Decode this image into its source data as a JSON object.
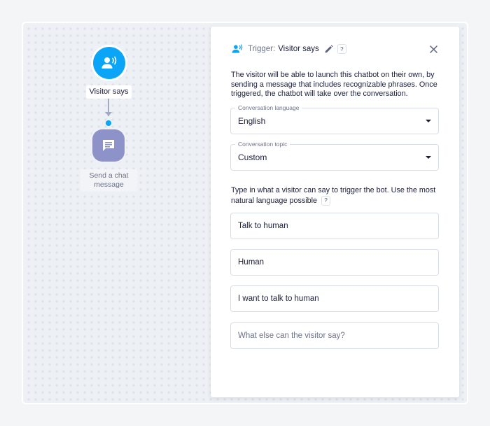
{
  "canvas": {
    "nodes": [
      {
        "type": "trigger",
        "label": "Visitor says",
        "icon": "visitor-speaking-icon",
        "color": "#0ba5f7"
      },
      {
        "type": "action",
        "label": "Send a chat message",
        "icon": "chat-message-icon",
        "color": "#8d92c9"
      }
    ]
  },
  "panel": {
    "header": {
      "icon": "visitor-speaking-icon",
      "prefix": "Trigger:",
      "title": "Visitor says",
      "edit_icon": "pencil-icon",
      "help": "?",
      "close_icon": "close-icon"
    },
    "description": "The visitor will be able to launch this chatbot on their own, by sending a message that includes recognizable phrases. Once triggered, the chatbot will take over the conversation.",
    "language": {
      "label": "Conversation language",
      "value": "English"
    },
    "topic": {
      "label": "Conversation topic",
      "value": "Custom"
    },
    "phrases_label": "Type in what a visitor can say to trigger the bot. Use the most natural language possible",
    "phrases_help": "?",
    "phrases": [
      "Talk to human",
      "Human",
      "I want to talk to human"
    ],
    "new_phrase_placeholder": "What else can the visitor say?"
  }
}
